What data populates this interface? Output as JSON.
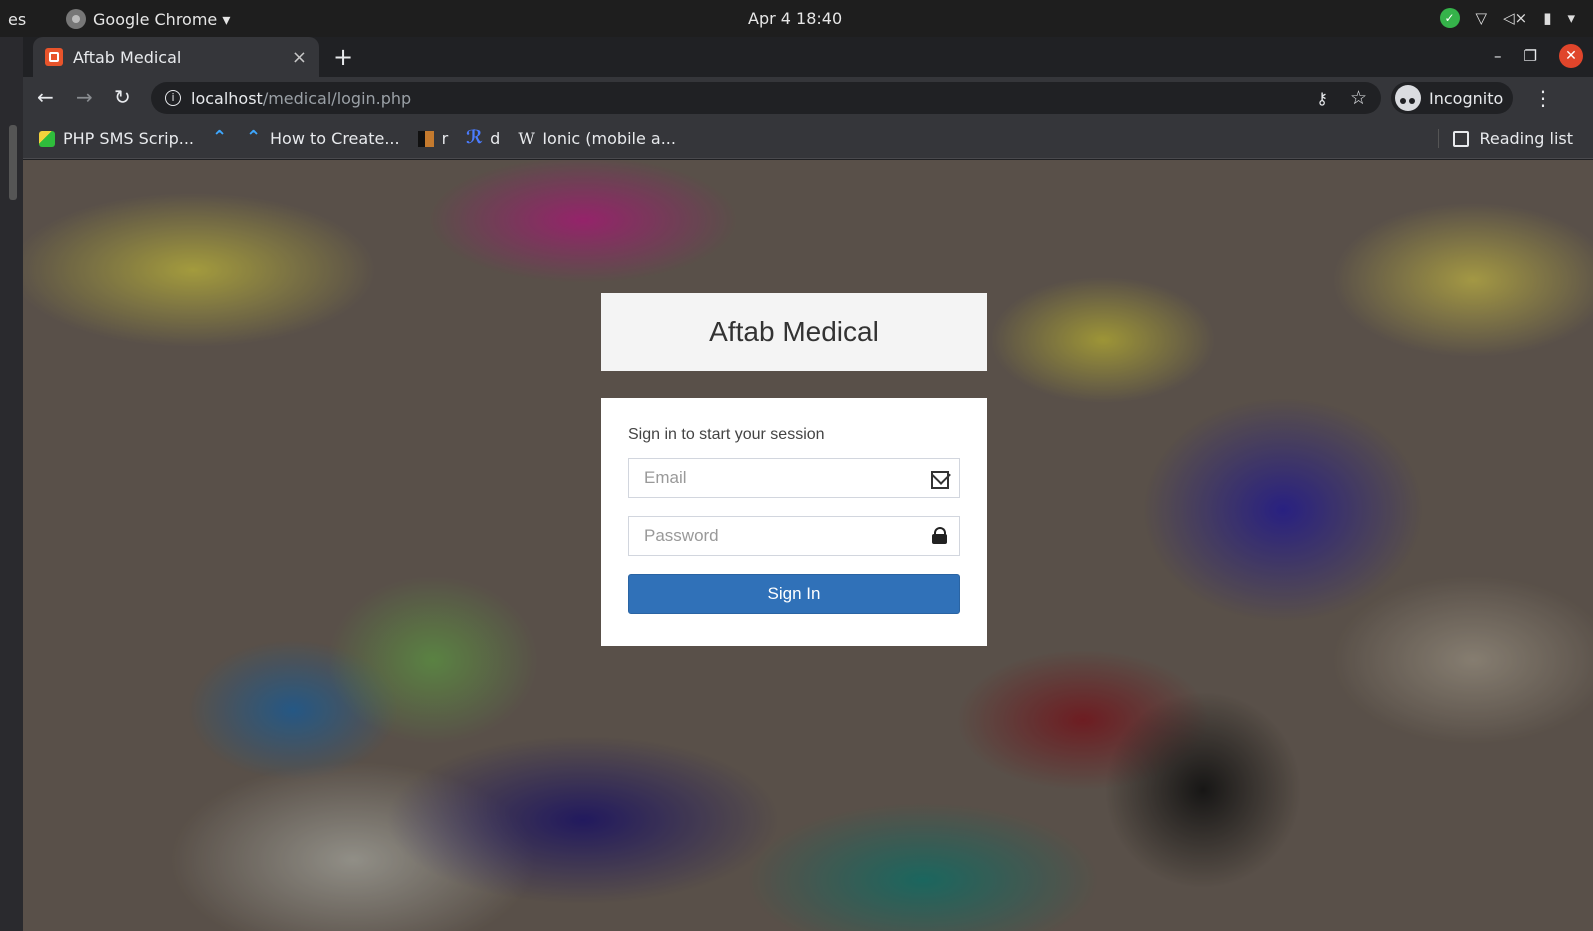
{
  "os": {
    "activities": "es",
    "app_name": "Google Chrome ▾",
    "clock": "Apr 4  18:40"
  },
  "browser": {
    "tab_title": "Aftab Medical",
    "tab_close": "×",
    "new_tab": "+",
    "url_host": "localhost",
    "url_path": "/medical/login.php",
    "incognito_label": "Incognito",
    "bookmarks": [
      {
        "label": "PHP SMS Scrip...",
        "icon": "sms-icon"
      },
      {
        "label": "",
        "icon": "arc-icon"
      },
      {
        "label": "How to Create...",
        "icon": "arc-icon"
      },
      {
        "label": "r",
        "icon": "book-icon"
      },
      {
        "label": "d",
        "icon": "d-icon"
      },
      {
        "label": "Ionic (mobile a...",
        "icon": "w-icon"
      }
    ],
    "reading_list": "Reading list"
  },
  "login": {
    "logo_text": "Aftab Medical",
    "message": "Sign in to start your session",
    "email_placeholder": "Email",
    "password_placeholder": "Password",
    "submit_label": "Sign In"
  },
  "colors": {
    "primary_button": "#3071b8",
    "tab_bg": "#35363a"
  }
}
